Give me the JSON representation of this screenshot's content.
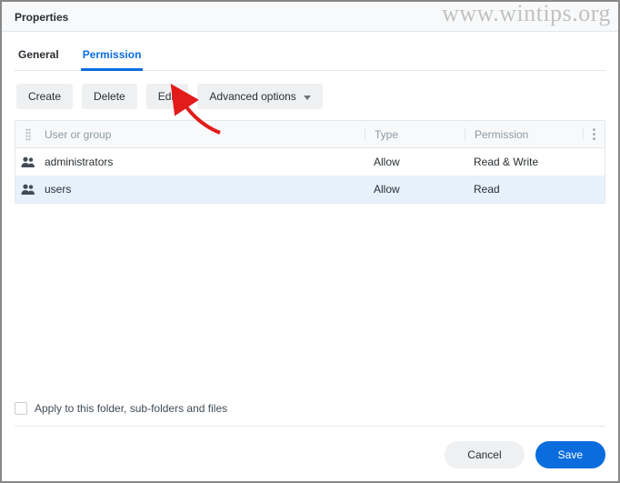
{
  "watermark": "www.wintips.org",
  "header": {
    "title": "Properties"
  },
  "tabs": {
    "general": "General",
    "permission": "Permission"
  },
  "toolbar": {
    "create": "Create",
    "delete": "Delete",
    "edit": "Edit",
    "advanced": "Advanced options"
  },
  "columns": {
    "user_or_group": "User or group",
    "type": "Type",
    "permission": "Permission"
  },
  "rows": [
    {
      "name": "administrators",
      "type": "Allow",
      "perm": "Read & Write"
    },
    {
      "name": "users",
      "type": "Allow",
      "perm": "Read"
    }
  ],
  "apply_label": "Apply to this folder, sub-folders and files",
  "buttons": {
    "cancel": "Cancel",
    "save": "Save"
  }
}
